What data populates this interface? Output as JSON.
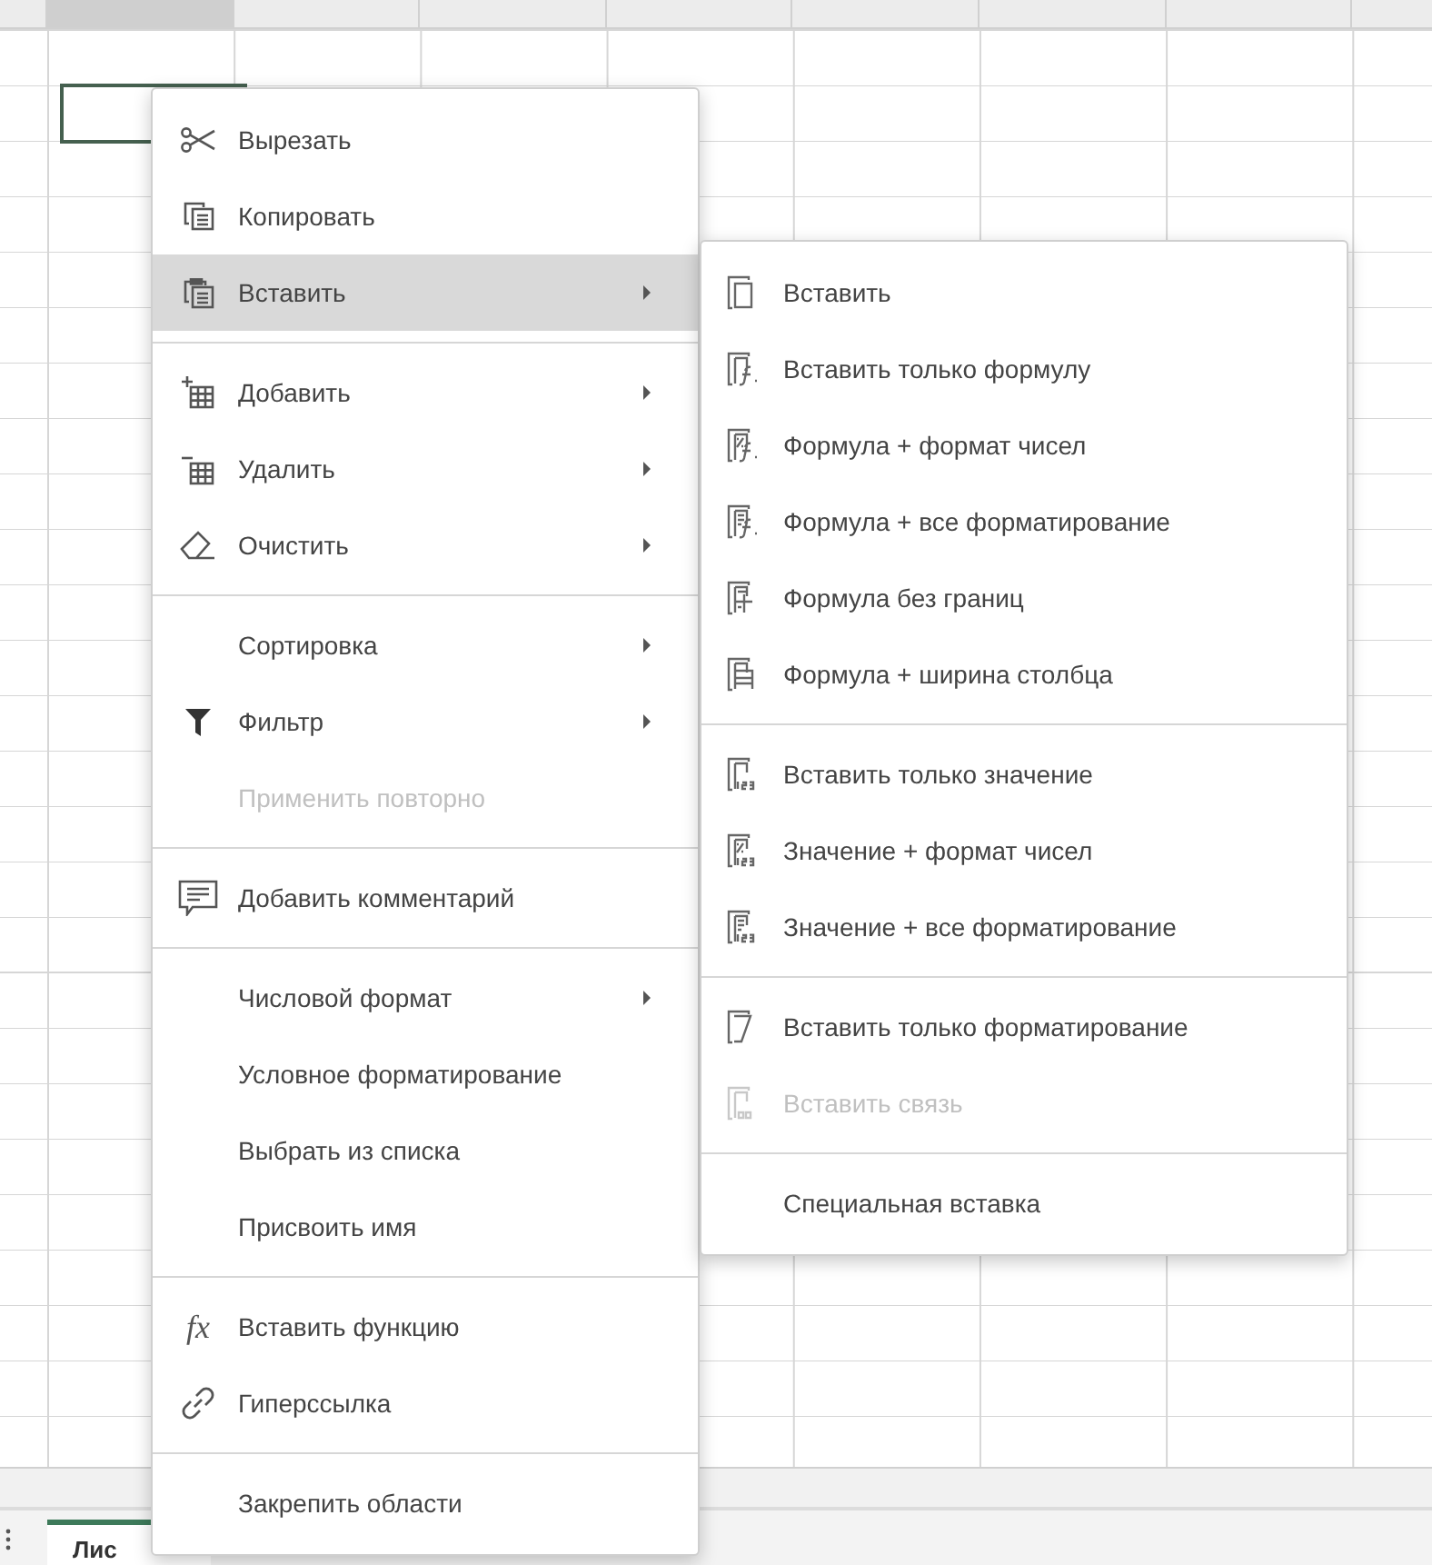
{
  "sheet": {
    "tabs": [
      {
        "label": "Лис",
        "selected": true
      }
    ]
  },
  "context_menu": {
    "groups": [
      [
        {
          "label": "Вырезать",
          "submenu": false,
          "disabled": false,
          "selected": false
        },
        {
          "label": "Копировать",
          "submenu": false,
          "disabled": false,
          "selected": false
        },
        {
          "label": "Вставить",
          "submenu": true,
          "disabled": false,
          "selected": true
        }
      ],
      [
        {
          "label": "Добавить",
          "submenu": true,
          "disabled": false,
          "selected": false
        },
        {
          "label": "Удалить",
          "submenu": true,
          "disabled": false,
          "selected": false
        },
        {
          "label": "Очистить",
          "submenu": true,
          "disabled": false,
          "selected": false
        }
      ],
      [
        {
          "label": "Сортировка",
          "submenu": true,
          "disabled": false,
          "selected": false
        },
        {
          "label": "Фильтр",
          "submenu": true,
          "disabled": false,
          "selected": false
        },
        {
          "label": "Применить повторно",
          "submenu": false,
          "disabled": true,
          "selected": false
        }
      ],
      [
        {
          "label": "Добавить комментарий",
          "submenu": false,
          "disabled": false,
          "selected": false
        }
      ],
      [
        {
          "label": "Числовой формат",
          "submenu": true,
          "disabled": false,
          "selected": false
        },
        {
          "label": "Условное форматирование",
          "submenu": false,
          "disabled": false,
          "selected": false
        },
        {
          "label": "Выбрать из списка",
          "submenu": false,
          "disabled": false,
          "selected": false
        },
        {
          "label": "Присвоить имя",
          "submenu": false,
          "disabled": false,
          "selected": false
        }
      ],
      [
        {
          "label": "Вставить функцию",
          "icon_text": "fx",
          "submenu": false,
          "disabled": false,
          "selected": false
        },
        {
          "label": "Гиперссылка",
          "submenu": false,
          "disabled": false,
          "selected": false
        }
      ],
      [
        {
          "label": "Закрепить области",
          "submenu": false,
          "disabled": false,
          "selected": false
        }
      ]
    ]
  },
  "paste_submenu": {
    "groups": [
      [
        {
          "label": "Вставить",
          "disabled": false,
          "selected": false
        },
        {
          "label": "Вставить только формулу",
          "disabled": false,
          "selected": false
        },
        {
          "label": "Формула + формат чисел",
          "disabled": false,
          "selected": false
        },
        {
          "label": "Формула + все форматирование",
          "disabled": false,
          "selected": false
        },
        {
          "label": "Формула без границ",
          "disabled": false,
          "selected": false
        },
        {
          "label": "Формула + ширина столбца",
          "disabled": false,
          "selected": false
        }
      ],
      [
        {
          "label": "Вставить только значение",
          "disabled": false,
          "selected": false
        },
        {
          "label": "Значение + формат чисел",
          "disabled": false,
          "selected": false
        },
        {
          "label": "Значение + все форматирование",
          "disabled": false,
          "selected": false
        }
      ],
      [
        {
          "label": "Вставить только форматирование",
          "disabled": false,
          "selected": false
        },
        {
          "label": "Вставить связь",
          "disabled": true,
          "selected": false
        }
      ],
      [
        {
          "label": "Специальная вставка",
          "disabled": false,
          "selected": false
        }
      ]
    ]
  }
}
